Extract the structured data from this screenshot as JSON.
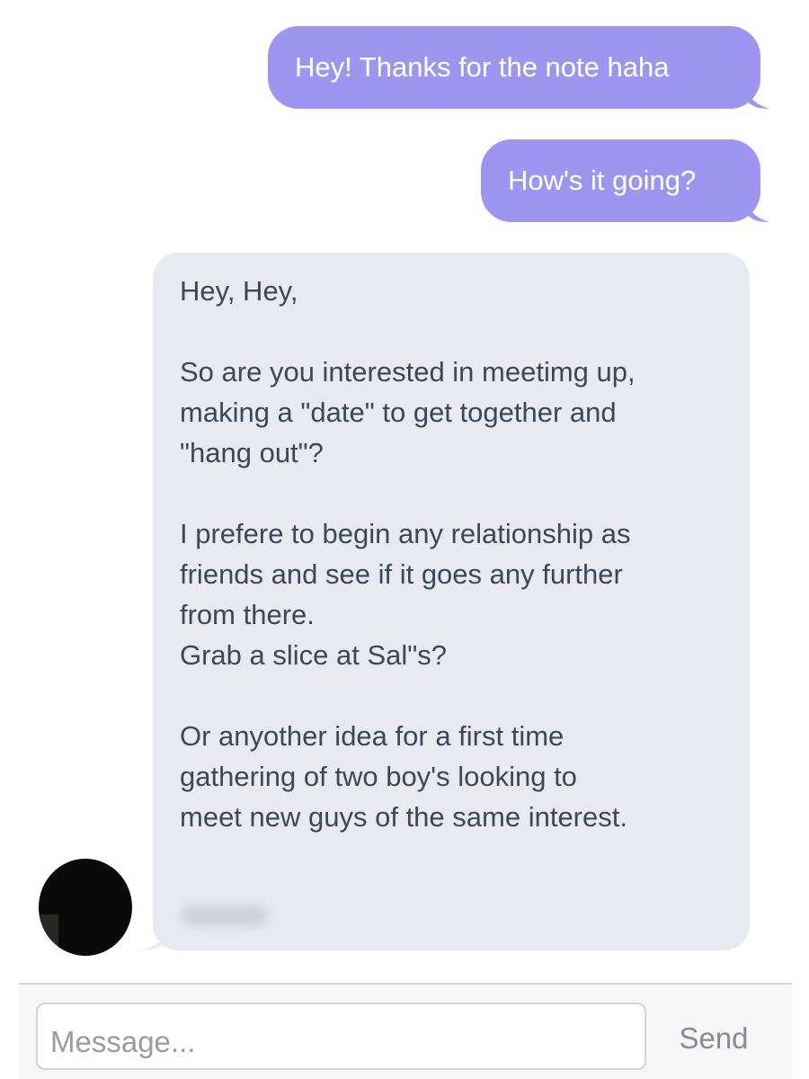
{
  "thread": {
    "outgoing": [
      {
        "text": "Hey! Thanks for the note haha"
      },
      {
        "text": "How's it going?"
      }
    ],
    "incoming": {
      "paragraphs": [
        [
          "Hey, Hey,"
        ],
        [
          "So are you interested in meetimg up,",
          "making a \"date\" to get together and",
          "\"hang out\"?"
        ],
        [
          "I prefere to begin any relationship as",
          "friends and see if it goes any further",
          "from there.",
          "Grab a slice at Sal\"s?"
        ],
        [
          "Or anyother idea for a first time",
          "gathering of two boy's looking to",
          "meet new guys of the same interest."
        ]
      ]
    }
  },
  "composer": {
    "placeholder": "Message...",
    "send_label": "Send"
  },
  "colors": {
    "outgoing_bubble": "#9e95f0",
    "incoming_bubble": "#e9e9f1",
    "incoming_text": "#3e4757"
  }
}
